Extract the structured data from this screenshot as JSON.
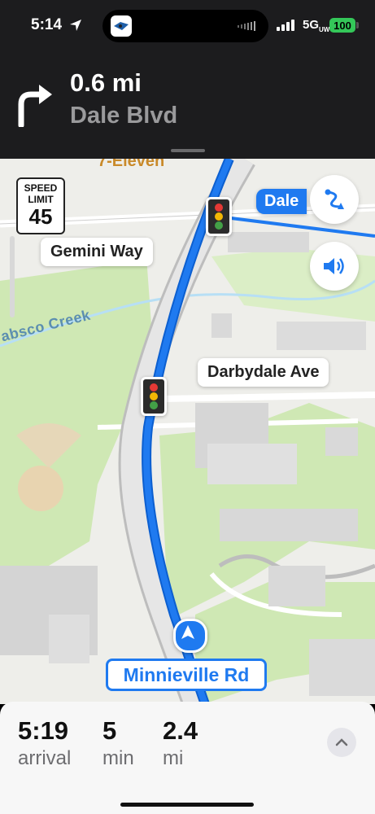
{
  "status_bar": {
    "time": "5:14",
    "network": "5G",
    "network_sub": "UW",
    "battery": "100"
  },
  "navigation": {
    "distance": "0.6 mi",
    "street": "Dale Blvd",
    "turn_icon": "turn-right-icon"
  },
  "map": {
    "speed_limit_label_1": "SPEED",
    "speed_limit_label_2": "LIMIT",
    "speed_limit_value": "45",
    "poi_name": "7-Eleven",
    "creek_name": "absco Creek",
    "callouts": {
      "gemini": "Gemini Way",
      "darbydale": "Darbydale Ave",
      "dale": "Dale"
    },
    "current_road": "Minnieville Rd"
  },
  "trip": {
    "arrival_value": "5:19",
    "arrival_label": "arrival",
    "duration_value": "5",
    "duration_label": "min",
    "distance_value": "2.4",
    "distance_label": "mi"
  },
  "colors": {
    "route_blue": "#1f7af0",
    "park_green": "#cfe8b4",
    "battery_green": "#34c759"
  }
}
